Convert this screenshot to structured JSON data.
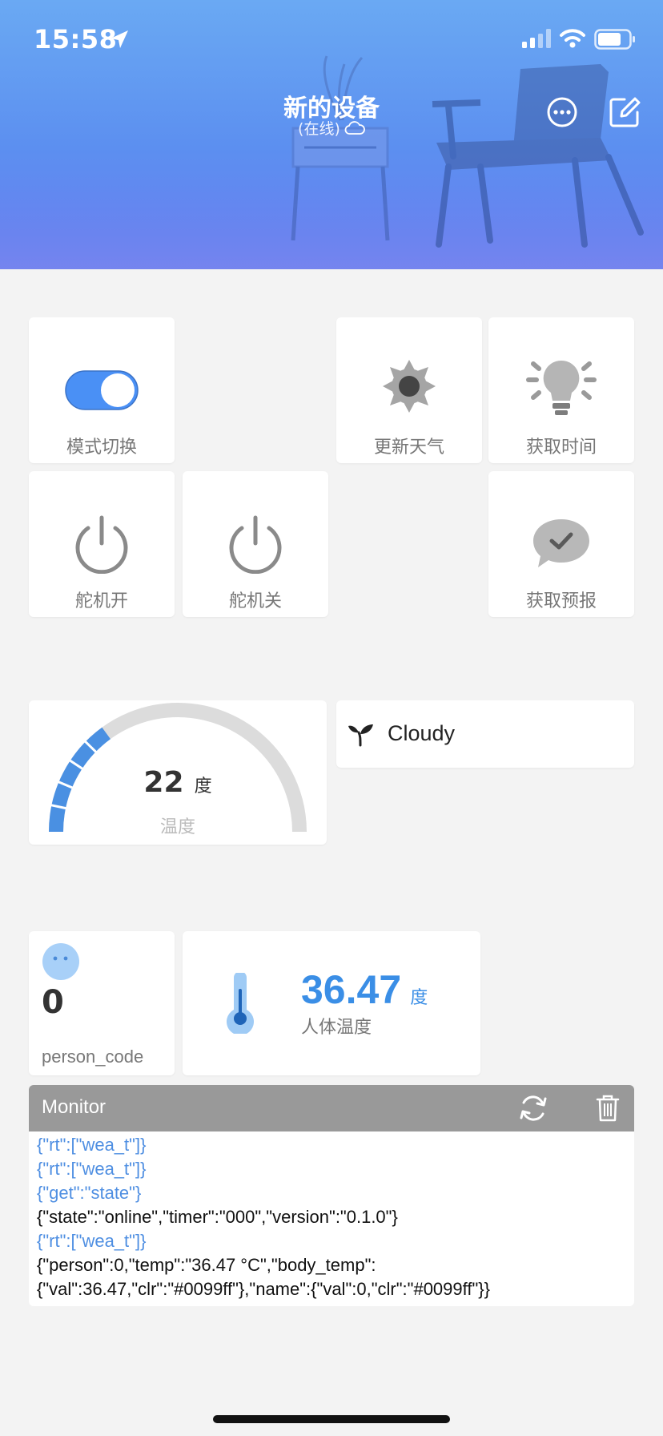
{
  "status_bar": {
    "time": "15:58"
  },
  "device": {
    "title": "新的设备",
    "status": "(在线)"
  },
  "widgets": {
    "mode_switch": {
      "label": "模式切换",
      "on": true
    },
    "update_weather": {
      "label": "更新天气"
    },
    "get_time": {
      "label": "获取时间"
    },
    "servo_on": {
      "label": "舵机开"
    },
    "servo_off": {
      "label": "舵机关"
    },
    "get_forecast": {
      "label": "获取预报"
    },
    "temperature_gauge": {
      "value": "22",
      "unit": "度",
      "label": "温度",
      "fraction": 0.3
    },
    "weather_text": {
      "value": "Cloudy"
    },
    "person": {
      "value": "0",
      "label": "person_code"
    },
    "body_temp": {
      "value": "36.47",
      "unit": "度",
      "label": "人体温度"
    }
  },
  "monitor": {
    "title": "Monitor",
    "logs": [
      {
        "text": "{\"rt\":[\"wea_t\"]}",
        "color": "blue"
      },
      {
        "text": "{\"rt\":[\"wea_t\"]}",
        "color": "blue"
      },
      {
        "text": "{\"get\":\"state\"}",
        "color": "blue"
      },
      {
        "text": "{\"state\":\"online\",\"timer\":\"000\",\"version\":\"0.1.0\"}",
        "color": "black"
      },
      {
        "text": "{\"rt\":[\"wea_t\"]}",
        "color": "blue"
      },
      {
        "text": "{\"person\":0,\"temp\":\"36.47 °C\",\"body_temp\":",
        "color": "black"
      },
      {
        "text": "{\"val\":36.47,\"clr\":\"#0099ff\"},\"name\":{\"val\":0,\"clr\":\"#0099ff\"}}",
        "color": "black"
      }
    ]
  },
  "colors": {
    "accent": "#4a90e2",
    "toggle": "#4a90f5",
    "body_temp": "#3a8ee6"
  }
}
